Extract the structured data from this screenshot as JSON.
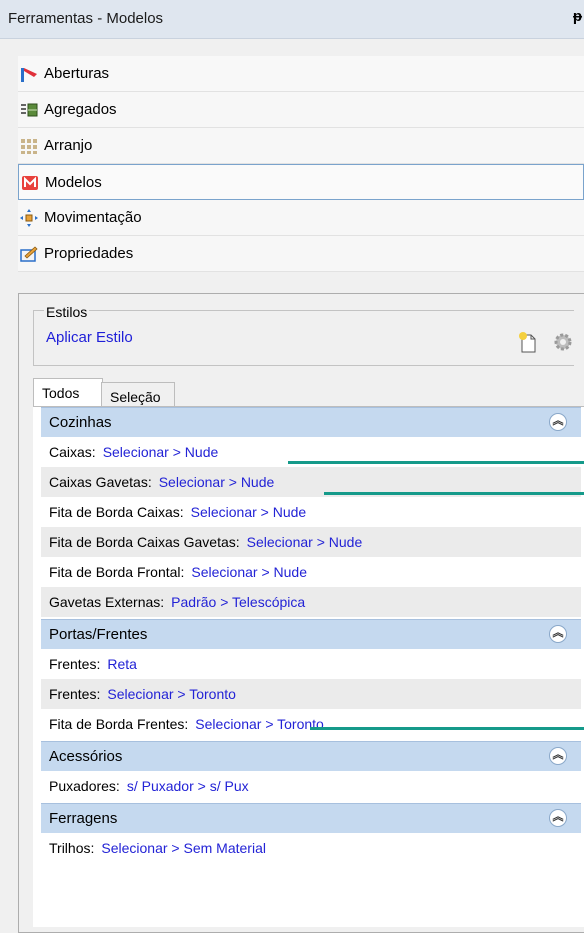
{
  "window": {
    "title": "Ferramentas - Modelos",
    "pin_glyph": "ᵽ"
  },
  "nav": [
    {
      "label": "Aberturas",
      "icon": "aberturas-icon"
    },
    {
      "label": "Agregados",
      "icon": "agregados-icon"
    },
    {
      "label": "Arranjo",
      "icon": "arranjo-icon"
    },
    {
      "label": "Modelos",
      "icon": "modelos-icon",
      "selected": true
    },
    {
      "label": "Movimentação",
      "icon": "movimentacao-icon"
    },
    {
      "label": "Propriedades",
      "icon": "propriedades-icon"
    }
  ],
  "styles": {
    "legend": "Estilos",
    "apply_label": "Aplicar Estilo"
  },
  "tabs": {
    "all": "Todos",
    "selection": "Seleção",
    "active": "all"
  },
  "groups": [
    {
      "title": "Cozinhas",
      "rows": [
        {
          "label": "Caixas:",
          "value": "Selecionar > Nude"
        },
        {
          "label": "Caixas Gavetas:",
          "value": "Selecionar > Nude"
        },
        {
          "label": "Fita de Borda Caixas:",
          "value": "Selecionar > Nude"
        },
        {
          "label": "Fita de Borda Caixas Gavetas:",
          "value": "Selecionar > Nude"
        },
        {
          "label": "Fita de Borda Frontal:",
          "value": "Selecionar > Nude"
        },
        {
          "label": "Gavetas Externas:",
          "value": "Padrão > Telescópica"
        }
      ]
    },
    {
      "title": "Portas/Frentes",
      "rows": [
        {
          "label": "Frentes:",
          "value": "Reta"
        },
        {
          "label": "Frentes:",
          "value": "Selecionar > Toronto"
        },
        {
          "label": "Fita de Borda Frentes:",
          "value": "Selecionar > Toronto"
        }
      ]
    },
    {
      "title": "Acessórios",
      "rows": [
        {
          "label": "Puxadores:",
          "value": "s/ Puxador > s/ Pux"
        }
      ]
    },
    {
      "title": "Ferragens",
      "rows": [
        {
          "label": "Trilhos:",
          "value": "Selecionar > Sem Material"
        }
      ]
    }
  ],
  "colors": {
    "link": "#2323d6",
    "group_header": "#c5d9ef",
    "callout": "#159a8a",
    "selected_border": "#7aa3cc"
  }
}
